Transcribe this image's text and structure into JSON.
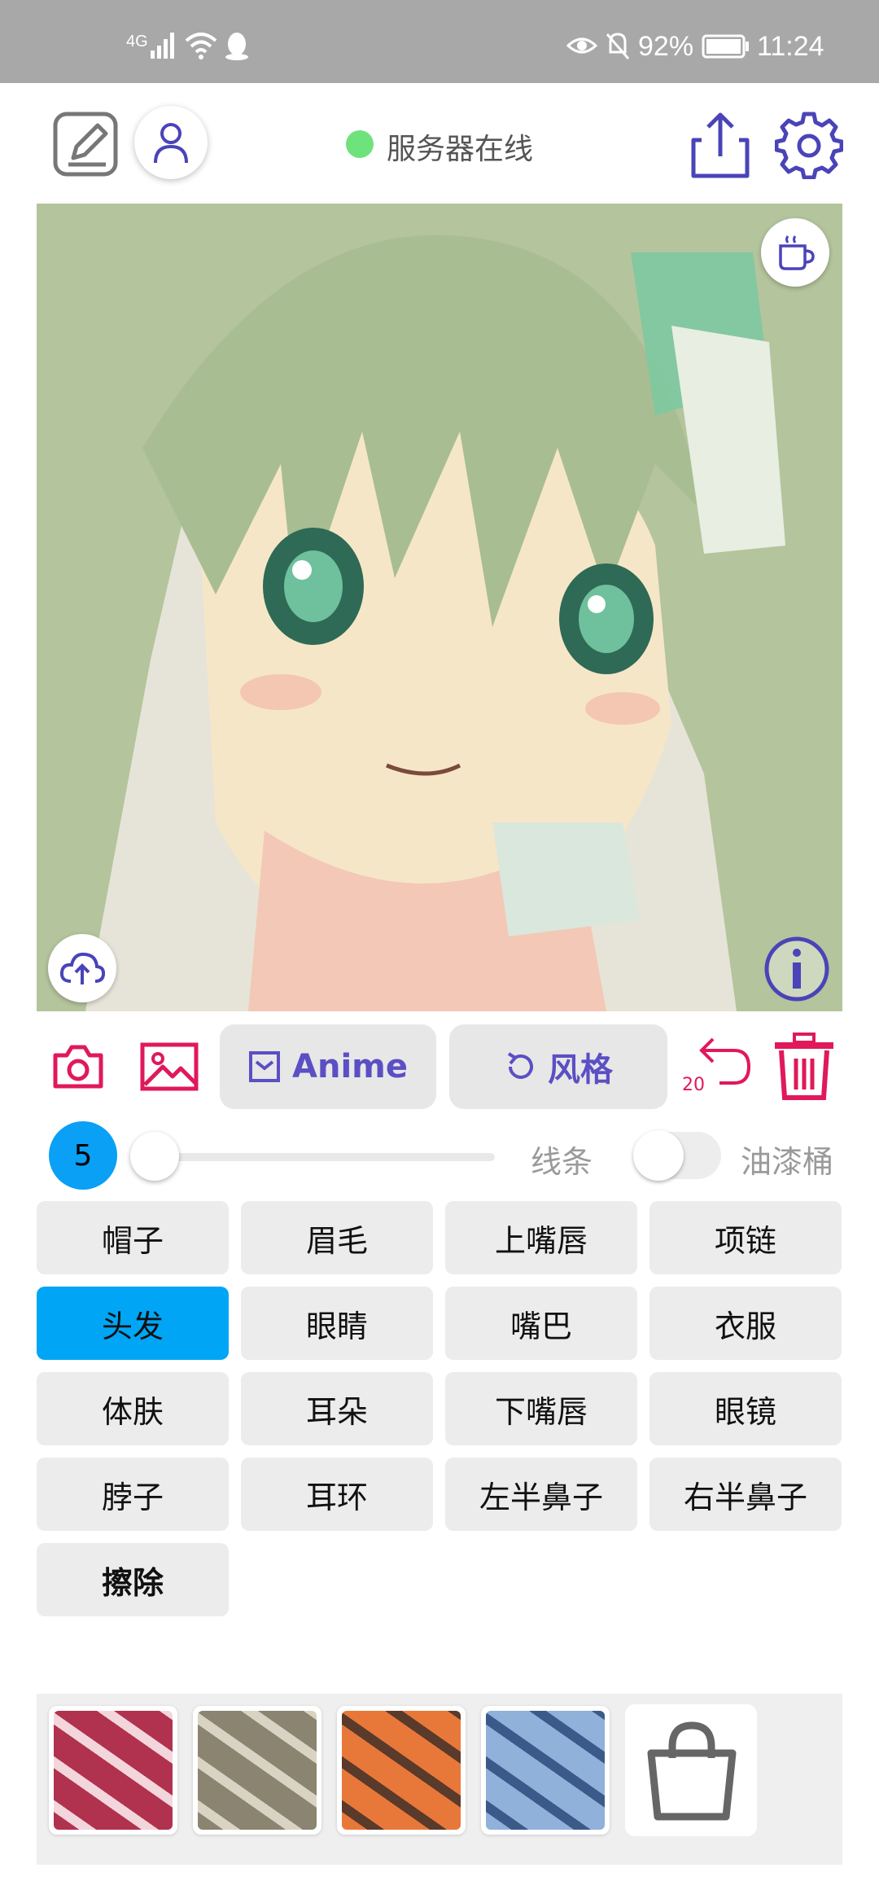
{
  "status_bar": {
    "network": "4G",
    "battery": "92%",
    "time": "11:24"
  },
  "header": {
    "server_status": "服务器在线",
    "status_color": "#6ee37b",
    "icons": [
      "edit-square-icon",
      "user-icon",
      "share-upload-icon",
      "gear-icon"
    ]
  },
  "canvas": {
    "icons": [
      "coffee-cup-icon",
      "cloud-upload-icon",
      "info-icon"
    ]
  },
  "toolbar": {
    "mode_label": "Anime",
    "style_label": "风格",
    "undo_count": "20",
    "accent": "#e0195a",
    "pill_text_color": "#5b4fc4"
  },
  "controls": {
    "brush_size": "5",
    "brush_slider_level": 0.0,
    "line_label": "线条",
    "bucket_label": "油漆桶",
    "bucket_enabled": false
  },
  "parts": [
    {
      "label": "帽子"
    },
    {
      "label": "眉毛"
    },
    {
      "label": "上嘴唇"
    },
    {
      "label": "项链"
    },
    {
      "label": "头发",
      "selected": true
    },
    {
      "label": "眼睛"
    },
    {
      "label": "嘴巴"
    },
    {
      "label": "衣服"
    },
    {
      "label": "体肤"
    },
    {
      "label": "耳朵"
    },
    {
      "label": "下嘴唇"
    },
    {
      "label": "眼镜"
    },
    {
      "label": "脖子"
    },
    {
      "label": "耳环"
    },
    {
      "label": "左半鼻子"
    },
    {
      "label": "右半鼻子"
    },
    {
      "label": "擦除",
      "bold": true
    }
  ],
  "textures": [
    {
      "name": "red-swirl-texture",
      "colors": [
        "#b1324e",
        "#f3d6dc"
      ]
    },
    {
      "name": "stone-texture",
      "colors": [
        "#8a8470",
        "#d8d3c2"
      ]
    },
    {
      "name": "orange-texture",
      "colors": [
        "#e8783a",
        "#5a3a2a"
      ]
    },
    {
      "name": "blue-texture",
      "colors": [
        "#8fb1da",
        "#3b5a8a"
      ]
    }
  ],
  "shop_icon": "shopping-bag-icon"
}
